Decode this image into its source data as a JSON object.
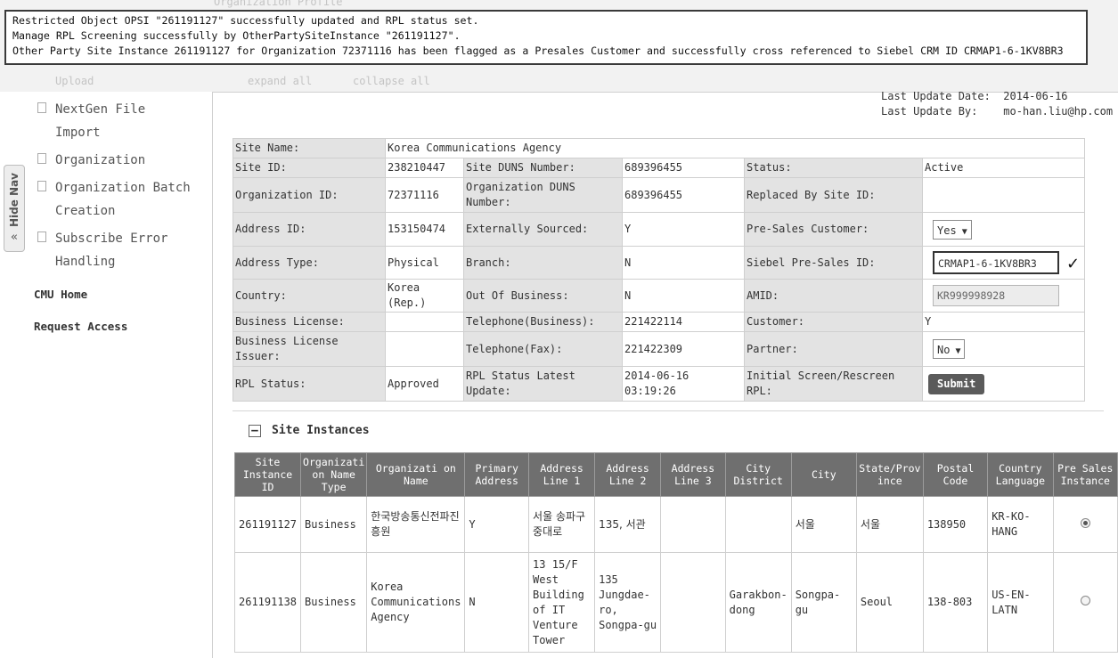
{
  "header": {
    "ghost_title": "Organization Profile",
    "ghost_upload": "Upload",
    "ghost_expand": "expand all",
    "ghost_collapse": "collapse all"
  },
  "notice": {
    "lines": [
      "Restricted Object OPSI \"261191127\" successfully updated and RPL status set.",
      "Manage RPL Screening successfully by OtherPartySiteInstance \"261191127\".",
      "Other Party Site Instance 261191127 for Organization 72371116 has been flagged as a Presales Customer and successfully cross referenced to Siebel CRM ID CRMAP1-6-1KV8BR3"
    ]
  },
  "nav": {
    "hide_nav": "Hide Nav",
    "items": [
      {
        "line1": "NextGen File",
        "line2": "Import"
      },
      {
        "line1": "Organization",
        "line2": ""
      },
      {
        "line1": "Organization Batch",
        "line2": "Creation"
      },
      {
        "line1": "Subscribe Error",
        "line2": "Handling"
      }
    ],
    "links": [
      "CMU Home",
      "Request Access"
    ]
  },
  "update": {
    "date_label": "Last Update Date:",
    "date_value": "2014-06-16",
    "by_label": "Last Update By:",
    "by_value": "mo-han.liu@hp.com"
  },
  "site": {
    "site_name_label": "Site Name:",
    "site_name": "Korea Communications Agency",
    "site_id_label": "Site ID:",
    "site_id": "238210447",
    "site_duns_label": "Site DUNS Number:",
    "site_duns": "689396455",
    "status_label": "Status:",
    "status": "Active",
    "org_id_label": "Organization ID:",
    "org_id": "72371116",
    "org_duns_label": "Organization DUNS Number:",
    "org_duns": "689396455",
    "replaced_label": "Replaced By Site ID:",
    "replaced": "",
    "address_id_label": "Address ID:",
    "address_id": "153150474",
    "ext_sourced_label": "Externally Sourced:",
    "ext_sourced": "Y",
    "presales_label": "Pre-Sales Customer:",
    "presales": "Yes",
    "address_type_label": "Address Type:",
    "address_type": "Physical",
    "branch_label": "Branch:",
    "branch": "N",
    "siebel_label": "Siebel Pre-Sales ID:",
    "siebel": "CRMAP1-6-1KV8BR3",
    "country_label": "Country:",
    "country": "Korea (Rep.)",
    "oob_label": "Out Of Business:",
    "oob": "N",
    "amid_label": "AMID:",
    "amid": "KR999998928",
    "bl_label": "Business License:",
    "bl": "",
    "tel_label": "Telephone(Business):",
    "tel": "221422114",
    "customer_label": "Customer:",
    "customer": "Y",
    "bli_label": "Business License Issuer:",
    "bli": "",
    "fax_label": "Telephone(Fax):",
    "fax": "221422309",
    "partner_label": "Partner:",
    "partner": "No",
    "rpl_label": "RPL Status:",
    "rpl": "Approved",
    "rpl_upd_label": "RPL Status Latest Update:",
    "rpl_upd": "2014-06-16 03:19:26",
    "init_label": "Initial Screen/Rescreen RPL:",
    "submit": "Submit"
  },
  "instances": {
    "title": "Site Instances",
    "collapse_glyph": "−",
    "headers": [
      "Site Instance ID",
      "Organizati on Name Type",
      "Organizati on Name",
      "Primary Address",
      "Address Line 1",
      "Address Line 2",
      "Address Line 3",
      "City District",
      "City",
      "State/Prov ince",
      "Postal Code",
      "Country Language",
      "Pre Sales Instance"
    ],
    "rows": [
      {
        "id": "261191127",
        "type": "Business",
        "name": "한국방송통신전파진흥원",
        "primary": "Y",
        "line1": "서울 송파구 중대로",
        "line2": "135, 서관",
        "line3": "",
        "district": "",
        "city": "서울",
        "state": "서울",
        "postal": "138950",
        "lang": "KR-KO-HANG",
        "selected": true
      },
      {
        "id": "261191138",
        "type": "Business",
        "name": "Korea Communications Agency",
        "primary": "N",
        "line1": "13 15/F West Building of IT Venture Tower",
        "line2": "135 Jungdae-ro, Songpa-gu",
        "line3": "",
        "district": "Garakbon-dong",
        "city": "Songpa-gu",
        "state": "Seoul",
        "postal": "138-803",
        "lang": "US-EN-LATN",
        "selected": false
      }
    ]
  },
  "colors": {
    "header_bg": "#6f6f6f",
    "label_bg": "#e3e3e3",
    "submit_bg": "#5b5b5b"
  }
}
